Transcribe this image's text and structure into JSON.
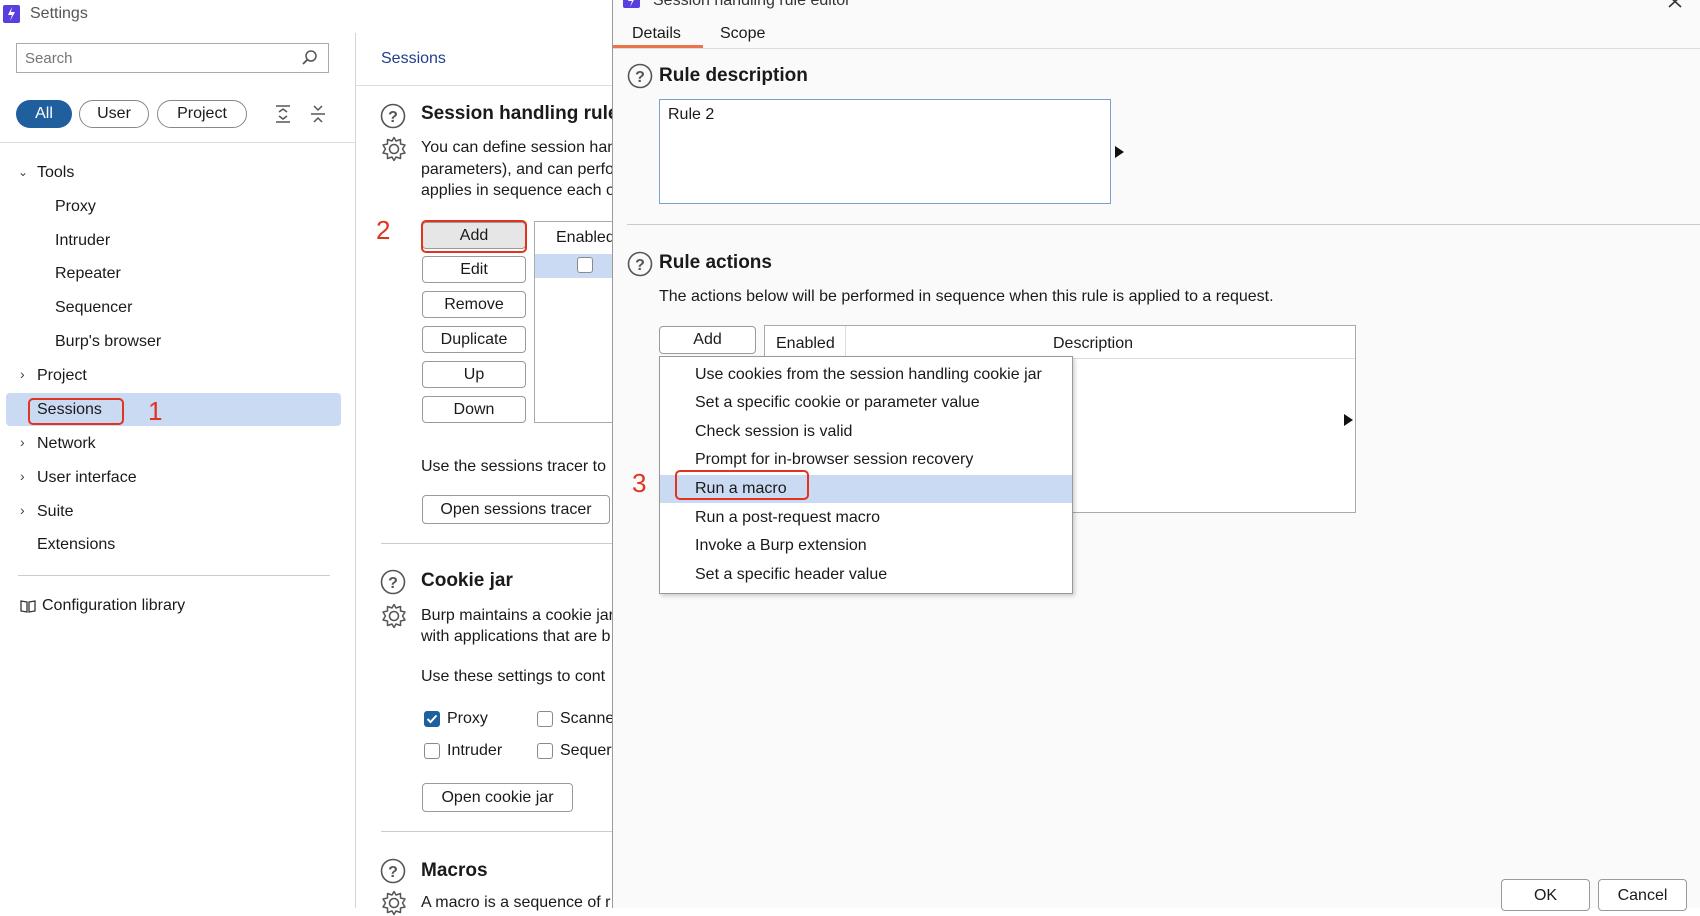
{
  "window": {
    "title": "Settings"
  },
  "sidebar": {
    "search_placeholder": "Search",
    "filters": [
      "All",
      "User",
      "Project"
    ],
    "tree": [
      {
        "label": "Tools",
        "expanded": true
      },
      {
        "label": "Proxy"
      },
      {
        "label": "Intruder"
      },
      {
        "label": "Repeater"
      },
      {
        "label": "Sequencer"
      },
      {
        "label": "Burp's browser"
      },
      {
        "label": "Project",
        "expanded": false
      },
      {
        "label": "Sessions",
        "selected": true
      },
      {
        "label": "Network",
        "expanded": false
      },
      {
        "label": "User interface",
        "expanded": false
      },
      {
        "label": "Suite",
        "expanded": false
      },
      {
        "label": "Extensions"
      }
    ],
    "config_library": "Configuration library"
  },
  "main": {
    "breadcrumb": "Sessions",
    "session_rules": {
      "title": "Session handling rule",
      "desc_lines": [
        "You can define session han",
        "parameters), and can perfo",
        "applies in sequence each o"
      ],
      "buttons": [
        "Add",
        "Edit",
        "Remove",
        "Duplicate",
        "Up",
        "Down"
      ],
      "table_header": "Enabled",
      "tracer_text": "Use the sessions tracer to",
      "open_tracer": "Open sessions tracer"
    },
    "cookie_jar": {
      "title": "Cookie jar",
      "desc_lines": [
        "Burp maintains a cookie jar",
        "with applications that are b"
      ],
      "use_text": "Use these settings to cont",
      "checks": [
        {
          "label": "Proxy",
          "checked": true
        },
        {
          "label": "Scanne",
          "checked": false
        },
        {
          "label": "Intruder",
          "checked": false
        },
        {
          "label": "Sequer",
          "checked": false
        }
      ],
      "open_button": "Open cookie jar"
    },
    "macros": {
      "title": "Macros",
      "desc": "A macro is a sequence of r"
    }
  },
  "dialog": {
    "title": "Session handling rule editor",
    "tabs": [
      "Details",
      "Scope"
    ],
    "rule_description": {
      "title": "Rule description",
      "value": "Rule 2"
    },
    "rule_actions": {
      "title": "Rule actions",
      "desc": "The actions below will be performed in sequence when this rule is applied to a request.",
      "add_button": "Add",
      "columns": [
        "Enabled",
        "Description"
      ]
    },
    "menu": [
      "Use cookies from the session handling cookie jar",
      "Set a specific cookie or parameter value",
      "Check session is valid",
      "Prompt for in-browser session recovery",
      "Run a macro",
      "Run a post-request macro",
      "Invoke a Burp extension",
      "Set a specific header value"
    ],
    "ok": "OK",
    "cancel": "Cancel"
  },
  "annotations": [
    "1",
    "2",
    "3"
  ],
  "colors": {
    "accent": "#1f5f9e",
    "selection": "#c9daf2",
    "highlight": "#e0341f",
    "tab_underline": "#e8764a"
  }
}
